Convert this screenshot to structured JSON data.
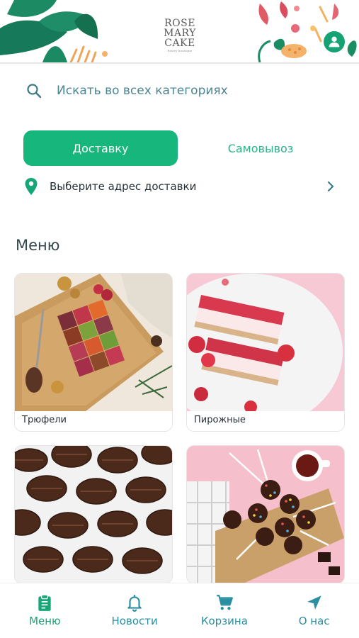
{
  "header": {
    "logo_line1": "ROSE",
    "logo_line2": "MARY",
    "logo_line3": "CAKE",
    "logo_sub": "Pastry boutique",
    "profile_icon": "user-icon",
    "accent_color": "#16a374"
  },
  "search": {
    "placeholder": "Искать во всех категориях",
    "icon": "search-icon"
  },
  "delivery": {
    "delivery_label": "Доставку",
    "pickup_label": "Самовывоз",
    "selected": "delivery",
    "active_color": "#17b67d"
  },
  "address": {
    "label": "Выберите адрес доставки",
    "icon": "location-pin-icon"
  },
  "menu": {
    "title": "Меню",
    "items": [
      {
        "label": "Трюфели"
      },
      {
        "label": "Пирожные"
      },
      {
        "label": ""
      },
      {
        "label": ""
      }
    ]
  },
  "bottom_nav": {
    "items": [
      {
        "label": "Меню",
        "icon": "clipboard-icon",
        "active": true
      },
      {
        "label": "Новости",
        "icon": "bell-icon",
        "active": false
      },
      {
        "label": "Корзина",
        "icon": "cart-icon",
        "active": false
      },
      {
        "label": "О нас",
        "icon": "navigation-arrow-icon",
        "active": false
      }
    ]
  }
}
